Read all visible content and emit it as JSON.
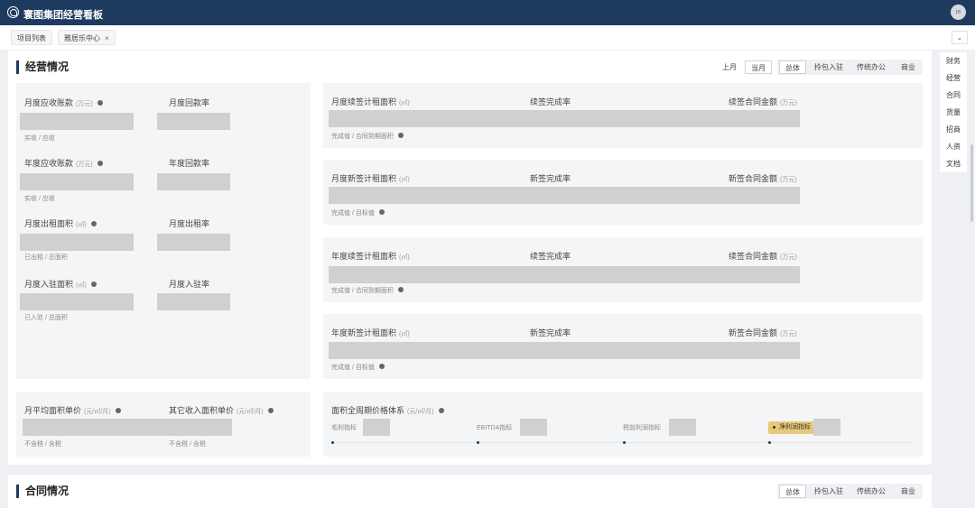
{
  "app": {
    "title": "寰图集团经营看板",
    "avatar_text": "ie"
  },
  "tabs": [
    {
      "label": "项目列表"
    },
    {
      "label": "雅居乐中心",
      "close": "×"
    }
  ],
  "collapse_icon": "chevron-down-icon",
  "right_nav": [
    "财务",
    "经营",
    "合同",
    "货量",
    "招商",
    "人资",
    "文档"
  ],
  "operations": {
    "title": "经营情况",
    "period_buttons": [
      "上月",
      "当月"
    ],
    "active_period": "当月",
    "scope_buttons": [
      "总体",
      "拎包入驻",
      "传统办公",
      "商业"
    ],
    "active_scope": "总体",
    "left_metrics": [
      {
        "label": "月度应收账款",
        "unit": "(万元)",
        "rate_label": "月度回款率",
        "sub": "实收 / 应收"
      },
      {
        "label": "年度应收账款",
        "unit": "(万元)",
        "rate_label": "年度回款率",
        "sub": "实收 / 应收"
      },
      {
        "label": "月度出租面积",
        "unit": "(㎡)",
        "rate_label": "月度出租率",
        "sub": "已出租 / 总面积"
      },
      {
        "label": "月度入驻面积",
        "unit": "(㎡)",
        "rate_label": "月度入驻率",
        "sub": "已入驻 / 总面积"
      }
    ],
    "right_cards": [
      {
        "label": "月度续签计租面积",
        "unit": "(㎡)",
        "rate_label": "续签完成率",
        "amount_label": "续签合同金额",
        "amount_unit": "(万元)",
        "sub": "完成值 / 合同到期面积"
      },
      {
        "label": "月度新签计租面积",
        "unit": "(㎡)",
        "rate_label": "新签完成率",
        "amount_label": "新签合同金额",
        "amount_unit": "(万元)",
        "sub": "完成值 / 目标值"
      },
      {
        "label": "年度续签计租面积",
        "unit": "(㎡)",
        "rate_label": "续签完成率",
        "amount_label": "续签合同金额",
        "amount_unit": "(万元)",
        "sub": "完成值 / 合同到期面积"
      },
      {
        "label": "年度新签计租面积",
        "unit": "(㎡)",
        "rate_label": "新签完成率",
        "amount_label": "新签合同金额",
        "amount_unit": "(万元)",
        "sub": "完成值 / 目标值"
      }
    ],
    "price": {
      "avg_label": "月平均面积单价",
      "avg_unit": "(元/㎡/月)",
      "avg_sub": "不含税 / 含税",
      "other_label": "其它收入面积单价",
      "other_unit": "(元/㎡/月)",
      "other_sub": "不含税 / 含税"
    },
    "price_system": {
      "label": "面积全周期价格体系",
      "unit": "(元/㎡/月)",
      "indicators": [
        "毛利指标",
        "EBITDA指标",
        "税前利润指标"
      ],
      "highlight": "净利润指标"
    }
  },
  "contracts": {
    "title": "合同情况",
    "scope_buttons": [
      "总体",
      "拎包入驻",
      "传统办公",
      "商业"
    ],
    "active_scope": "总体"
  }
}
